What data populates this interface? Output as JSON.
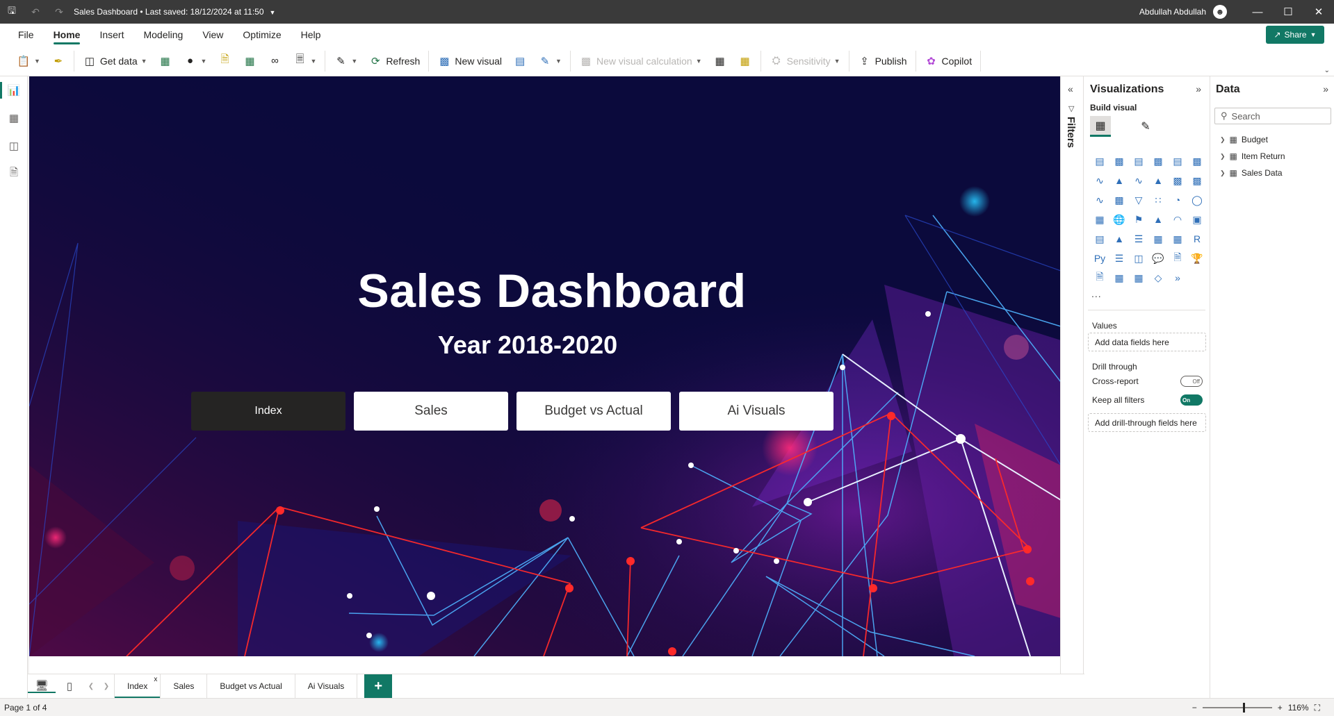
{
  "titlebar": {
    "title": "Sales Dashboard • Last saved: 18/12/2024 at 11:50",
    "user": "Abdullah Abdullah",
    "save_icon": "save-icon",
    "undo_icon": "undo-icon",
    "redo_icon": "redo-icon"
  },
  "menu": {
    "tabs": [
      "File",
      "Home",
      "Insert",
      "Modeling",
      "View",
      "Optimize",
      "Help"
    ],
    "share": "Share"
  },
  "ribbon": {
    "get_data": "Get data",
    "refresh": "Refresh",
    "new_visual": "New visual",
    "new_visual_calc": "New visual calculation",
    "sensitivity": "Sensitivity",
    "publish": "Publish",
    "copilot": "Copilot"
  },
  "report": {
    "title": "Sales Dashboard",
    "subtitle": "Year 2018-2020",
    "buttons": [
      "Index",
      "Sales",
      "Budget vs Actual",
      "Ai Visuals"
    ]
  },
  "filters": {
    "label": "Filters"
  },
  "visualizations": {
    "title": "Visualizations",
    "build_label": "Build visual",
    "values_label": "Values",
    "values_placeholder": "Add data fields here",
    "drill_label": "Drill through",
    "cross_report": "Cross-report",
    "cross_report_state": "Off",
    "keep_filters": "Keep all filters",
    "keep_filters_state": "On",
    "drill_placeholder": "Add drill-through fields here",
    "more": "..."
  },
  "data_pane": {
    "title": "Data",
    "search_placeholder": "Search",
    "tables": [
      "Budget",
      "Item Return",
      "Sales Data"
    ]
  },
  "pages": {
    "tabs": [
      "Index",
      "Sales",
      "Budget vs Actual",
      "Ai Visuals"
    ],
    "active": "Index",
    "add": "+"
  },
  "status": {
    "page_info": "Page 1 of 4",
    "zoom": "116%",
    "zoom_level_pct": 58
  },
  "colors": {
    "accent": "#117865",
    "canvas_bg": "#0b0a3c",
    "network_red": "#ff2a2a",
    "network_blue": "#4fb3ff"
  }
}
